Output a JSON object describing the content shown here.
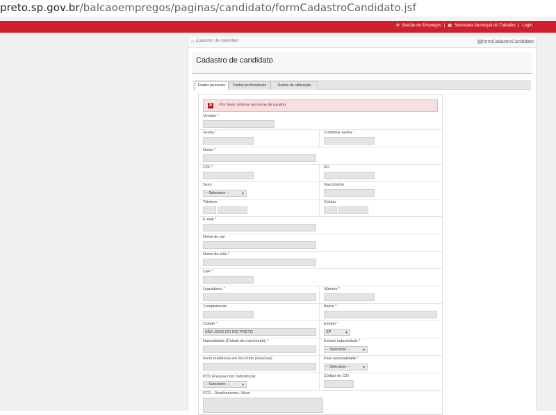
{
  "browser": {
    "url_host": "preto.sp.gov.br",
    "url_path": "/balcaoempregos/paginas/candidato/formCadastroCandidato.jsf"
  },
  "topbar": {
    "links": [
      "Balcão de Empregos",
      "Secretaria Municipal do Trabalho",
      "Login"
    ]
  },
  "breadcrumb": {
    "current": "Cadastro de candidato",
    "form_id": "formCadastroCandidato"
  },
  "page_title": "Cadastro de candidato",
  "tabs": [
    "Dados pessoais",
    "Dados profissionais",
    "Dados de utilização"
  ],
  "error_message": "Por favor, informe um nome de usuário.",
  "fields": {
    "usuario": "Usuário",
    "senha": "Senha",
    "confirmar_senha": "Confirmar senha",
    "nome": "Nome",
    "cpf": "CPF",
    "rg": "RG",
    "sexo": "Sexo",
    "sexo_value": "-- Selecione --",
    "nascimento": "Nascimento",
    "telefone": "Telefone",
    "celular": "Celular",
    "email": "E-mail",
    "nome_pai": "Nome do pai",
    "nome_mae": "Nome da mãe",
    "cep": "CEP",
    "logradouro": "Logradouro",
    "numero": "Número",
    "complemento": "Complemento",
    "bairro": "Bairro",
    "cidade": "Cidade",
    "cidade_value": "SÃO JOSÉ DO RIO PRETO",
    "estado": "Estado",
    "estado_value": "SP",
    "naturalidade": "Naturalidade (Cidade de nascimento)",
    "estado_naturalidade": "Estado naturalidade",
    "estado_naturalidade_value": "-- Selecione --",
    "inicio_residencia": "Início residência em Rio Preto (mês/ano)",
    "pais_nacionalidade": "País nacionalidade",
    "pais_nacionalidade_value": "-- Selecione --",
    "pcd": "PCD (Pessoa com Deficiência)",
    "pcd_value": "-- Selecione --",
    "codigo_cid": "Código do CID",
    "pcd_detalhamento": "PCD - Detalhamento / Nível"
  },
  "required_mark": "*",
  "colors": {
    "brand_red": "#d0202d",
    "error_bg": "#f7dfe0"
  }
}
